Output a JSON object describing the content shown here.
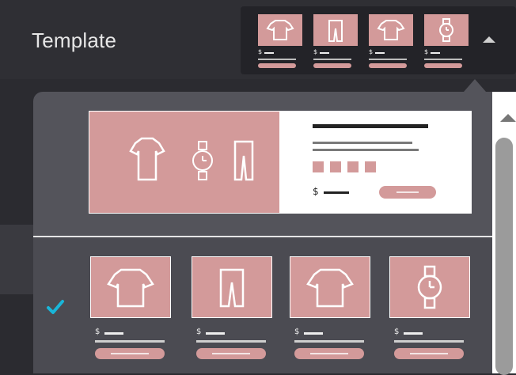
{
  "header": {
    "title": "Template"
  },
  "preview": {
    "thumbs": [
      {
        "icon": "tshirt-icon",
        "price_symbol": "$"
      },
      {
        "icon": "pants-icon",
        "price_symbol": "$"
      },
      {
        "icon": "tshirt-icon",
        "price_symbol": "$"
      },
      {
        "icon": "watch-icon",
        "price_symbol": "$"
      }
    ],
    "toggle_icon": "chevron-up-icon"
  },
  "dropdown": {
    "layouts": [
      {
        "id": "hero",
        "price_symbol": "$",
        "selected": false
      },
      {
        "id": "grid",
        "price_symbol": "$",
        "selected": true
      }
    ],
    "grid_items": [
      {
        "icon": "tshirt-icon",
        "price_symbol": "$"
      },
      {
        "icon": "pants-icon",
        "price_symbol": "$"
      },
      {
        "icon": "tshirt-icon",
        "price_symbol": "$"
      },
      {
        "icon": "watch-icon",
        "price_symbol": "$"
      }
    ]
  },
  "colors": {
    "accent": "#d39a9a",
    "check": "#19b6d9",
    "panel": "#54545b"
  }
}
